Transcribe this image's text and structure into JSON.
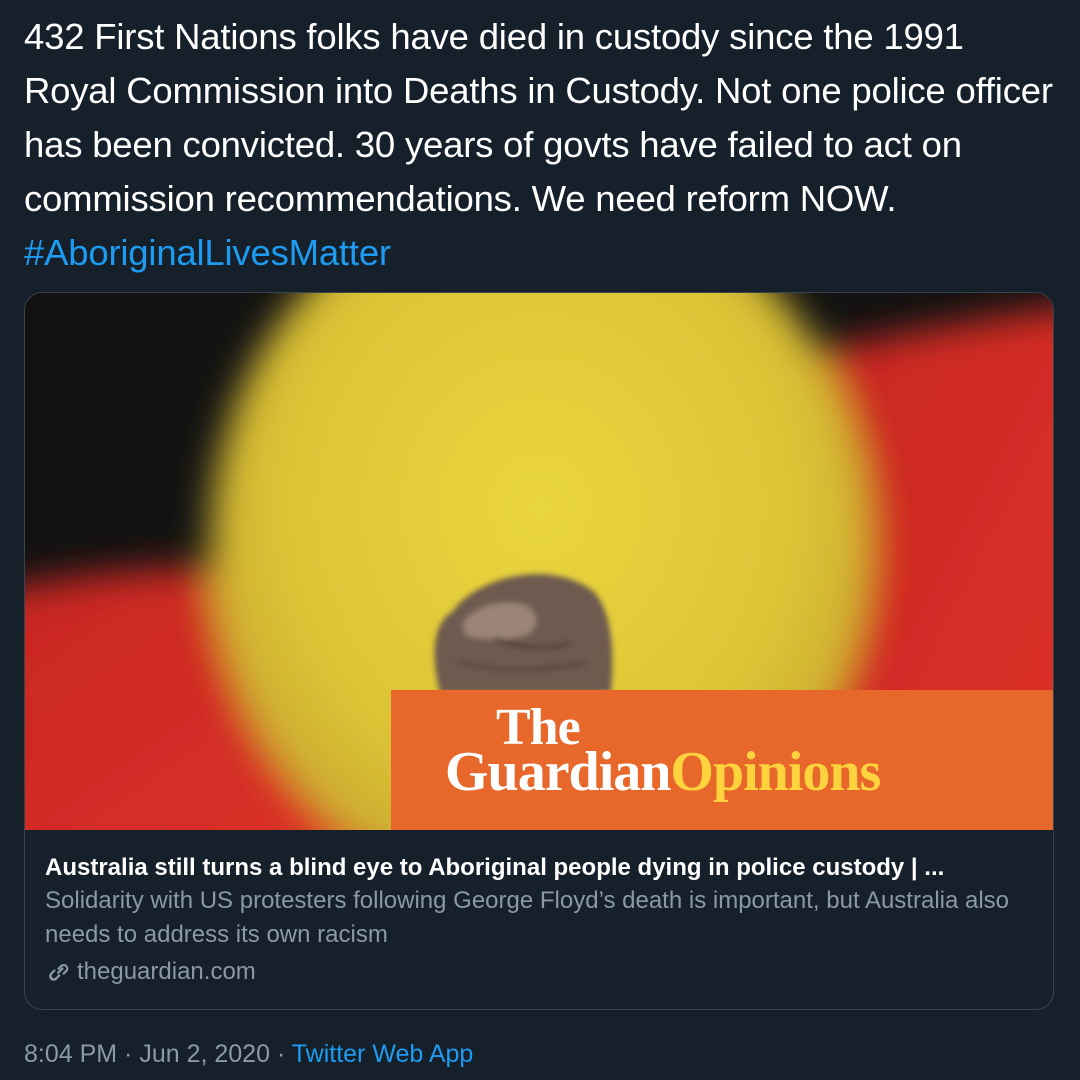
{
  "tweet": {
    "text": "432 First Nations folks have died in custody since the 1991 Royal Commission into Deaths in Custody. Not one police officer has been convicted. 30 years of govts have failed to act on commission recommendations. We need reform NOW. ",
    "hashtag": "#AboriginalLivesMatter"
  },
  "card": {
    "brand_the": "The",
    "brand_guardian": "Guardian",
    "brand_opinions": "Opinions",
    "title": "Australia still turns a blind eye to Aboriginal people dying in police custody | ...",
    "description": "Solidarity with US protesters following George Floyd’s death is important, but Australia also needs to address its own racism",
    "domain": "theguardian.com",
    "icon": "link-icon"
  },
  "meta": {
    "time": "8:04 PM",
    "separator1": " · ",
    "date": "Jun 2, 2020",
    "separator2": " · ",
    "source": "Twitter Web App"
  },
  "colors": {
    "background": "#15202b",
    "text": "#ffffff",
    "secondary": "#8b98a5",
    "link": "#1d9bf0",
    "flag_black": "#141414",
    "flag_red": "#d42a24",
    "flag_yellow": "#e8d23a",
    "brand_orange": "#e8672b",
    "brand_yellow": "#ffd33d"
  }
}
